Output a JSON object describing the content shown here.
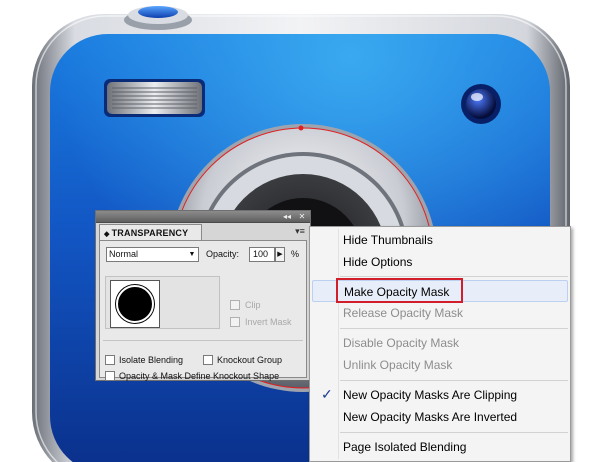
{
  "panel": {
    "title": "TRANSPARENCY",
    "title_arrows": "◆",
    "collapse_glyph": "◂◂",
    "close_glyph": "✕",
    "menu_glyph": "▾≡",
    "blend_mode": "Normal",
    "blend_arrow": "▼",
    "opacity_label": "Opacity:",
    "opacity_value": "100",
    "opacity_step": "▶",
    "opacity_unit": "%",
    "clip_label": "Clip",
    "invert_mask_label": "Invert Mask",
    "isolate_blending_label": "Isolate Blending",
    "knockout_group_label": "Knockout Group",
    "opacity_mask_label": "Opacity & Mask Define Knockout Shape"
  },
  "context_menu": {
    "items": [
      {
        "label": "Hide Thumbnails",
        "disabled": false
      },
      {
        "label": "Hide Options",
        "disabled": false
      },
      {
        "label": "Make Opacity Mask",
        "disabled": false,
        "highlighted": true
      },
      {
        "label": "Release Opacity Mask",
        "disabled": true
      },
      {
        "label": "Disable Opacity Mask",
        "disabled": true
      },
      {
        "label": "Unlink Opacity Mask",
        "disabled": true
      },
      {
        "label": "New Opacity Masks Are Clipping",
        "disabled": false,
        "checked": true
      },
      {
        "label": "New Opacity Masks Are Inverted",
        "disabled": false
      },
      {
        "label": "Page Isolated Blending",
        "disabled": false
      }
    ],
    "check_glyph": "✓"
  },
  "colors": {
    "camera_blue": "#1358c9",
    "camera_metal": "#c8ccd4",
    "highlight_box": "#d21e2b"
  }
}
